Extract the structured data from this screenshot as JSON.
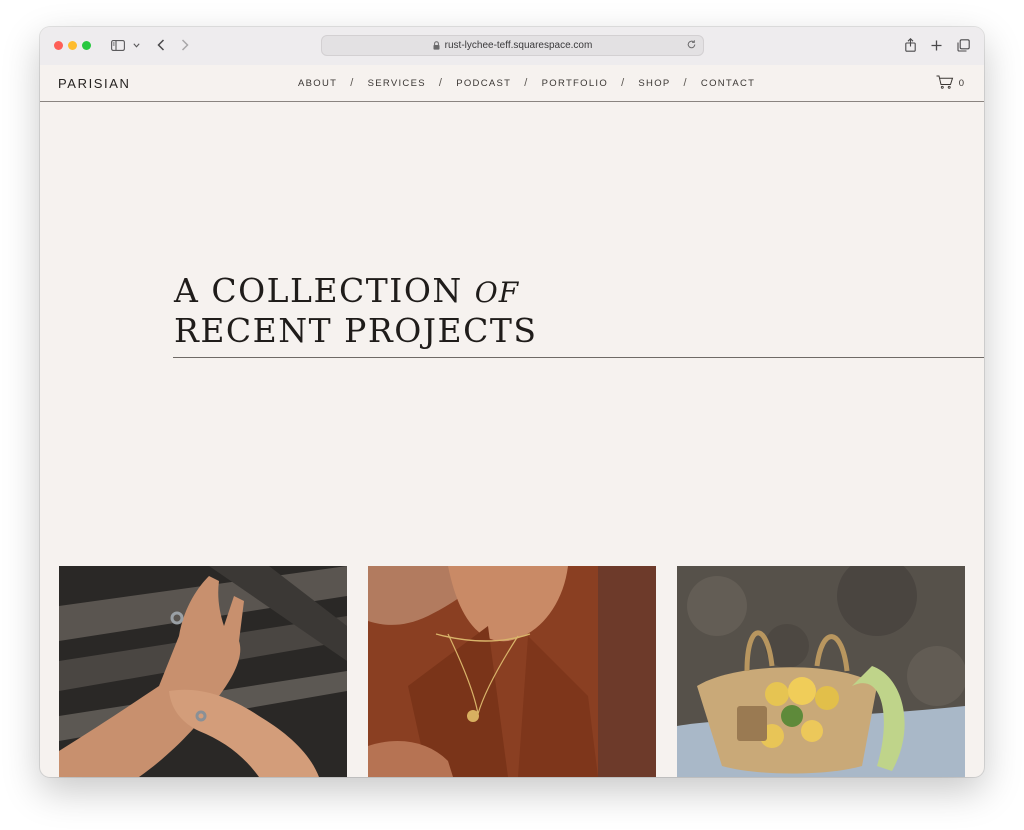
{
  "browser": {
    "url": "rust-lychee-teff.squarespace.com"
  },
  "site": {
    "logo": "PARISIAN",
    "nav": [
      {
        "label": "ABOUT"
      },
      {
        "label": "SERVICES"
      },
      {
        "label": "PODCAST"
      },
      {
        "label": "PORTFOLIO"
      },
      {
        "label": "SHOP"
      },
      {
        "label": "CONTACT"
      }
    ],
    "separator": "/",
    "cart_count": "0"
  },
  "hero": {
    "line1": "A COLLECTION",
    "line1_italic": "OF",
    "line2": "RECENT PROJECTS"
  },
  "tiles": [
    {
      "icon": "hands-with-rings-photo"
    },
    {
      "icon": "necklace-rust-shirt-photo"
    },
    {
      "icon": "straw-basket-lemons-photo"
    }
  ],
  "colors": {
    "page_bg": "#f6f2ef",
    "text": "#1f1c1a",
    "rule": "#6f6a66"
  }
}
